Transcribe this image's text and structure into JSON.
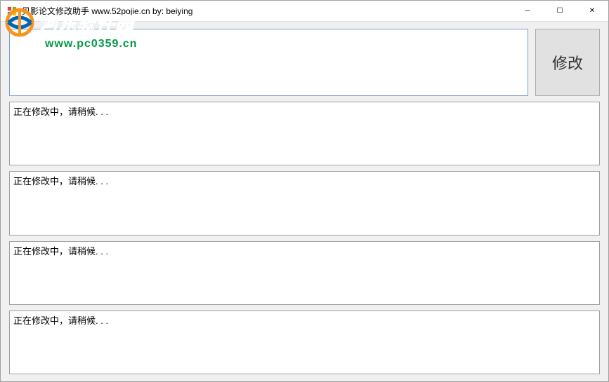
{
  "window": {
    "title": "贝影论文修改助手 www.52pojie.cn by: beiying"
  },
  "controls": {
    "minimize_symbol": "─",
    "maximize_symbol": "☐",
    "close_symbol": "✕"
  },
  "input": {
    "value": "",
    "placeholder": ""
  },
  "buttons": {
    "modify_label": "修改"
  },
  "outputs": [
    "正在修改中，请稍候. . .",
    "正在修改中，请稍候. . .",
    "正在修改中，请稍候. . .",
    "正在修改中，请稍候. . ."
  ],
  "watermark": {
    "brand": "河东软件园",
    "url": "www.pc0359.cn"
  }
}
